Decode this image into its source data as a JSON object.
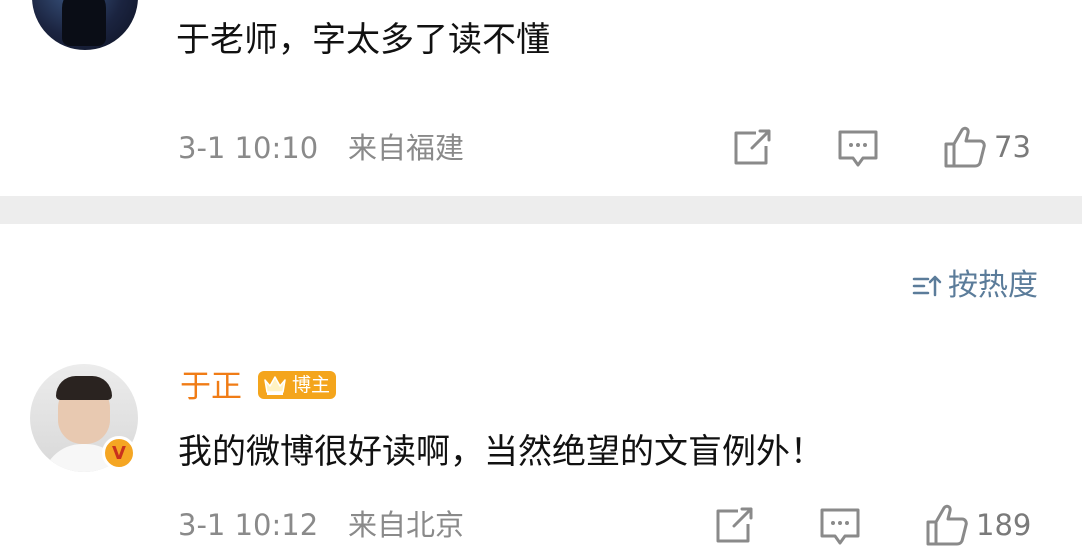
{
  "comments": [
    {
      "text": "于老师，字太多了读不懂",
      "time": "3-1 10:10",
      "location": "来自福建",
      "likes": "73"
    },
    {
      "username": "于正",
      "badge": "博主",
      "verified_mark": "V",
      "text": "我的微博很好读啊，当然绝望的文盲例外！",
      "time": "3-1 10:12",
      "location": "来自北京",
      "likes": "189"
    }
  ],
  "sort": {
    "label": "按热度",
    "icon": "sort-icon"
  },
  "icons": {
    "share": "share-icon",
    "comment": "comment-icon",
    "like": "like-icon",
    "crown": "crown-icon"
  },
  "colors": {
    "username": "#f07c16",
    "badge": "#f4a51c",
    "meta": "#8a8a8a",
    "sort": "#5b7c9a",
    "divider": "#ededed"
  }
}
